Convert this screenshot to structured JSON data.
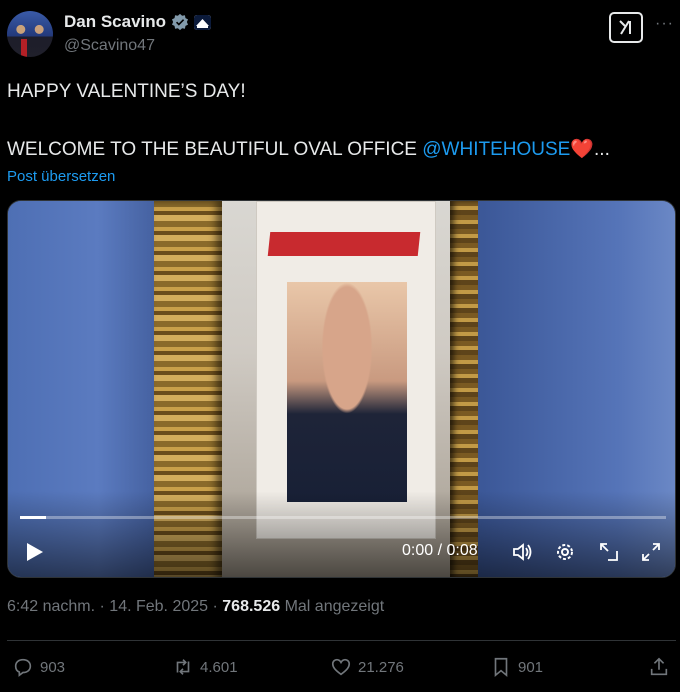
{
  "author": {
    "name": "Dan Scavino",
    "handle": "@Scavino47"
  },
  "tweet": {
    "line1": "HAPPY VALENTINE’S DAY!",
    "line2_prefix": "WELCOME TO THE BEAUTIFUL OVAL OFFICE ",
    "mention": "@WHITEHOUSE",
    "heart": "❤️",
    "ellipsis": "...",
    "translate_label": "Post übersetzen"
  },
  "video": {
    "time": "0:00 / 0:08",
    "progress": 0.04
  },
  "meta": {
    "time": "6:42 nachm.",
    "date": "14. Feb. 2025",
    "views": "768.526",
    "views_label": "Mal angezeigt",
    "sep": "·"
  },
  "actions": {
    "replies": "903",
    "reposts": "4.601",
    "likes": "21.276",
    "bookmarks": "901"
  },
  "icons": {
    "verified": "verified-badge-icon",
    "affiliation": "white-house-affiliation-icon",
    "grok": "grok-icon",
    "more": "more-icon",
    "play": "play-icon",
    "volume": "volume-icon",
    "settings": "settings-icon",
    "pip": "picture-in-picture-icon",
    "fullscreen": "fullscreen-icon",
    "reply": "reply-icon",
    "repost": "repost-icon",
    "like": "heart-icon",
    "bookmark": "bookmark-icon",
    "share": "share-icon"
  },
  "colors": {
    "accent": "#1d9bf0",
    "text": "#e7e9ea",
    "muted": "#71767b",
    "background": "#000000",
    "heart": "#f91880"
  }
}
